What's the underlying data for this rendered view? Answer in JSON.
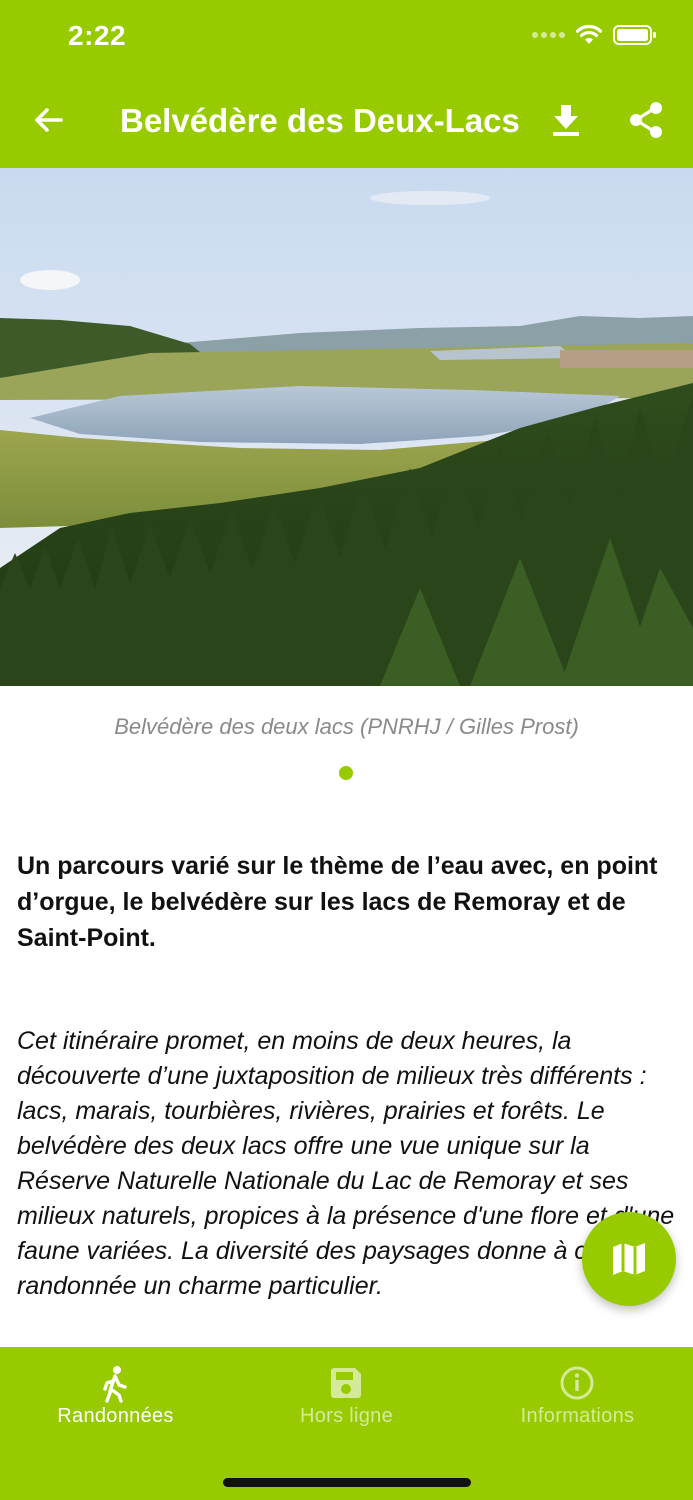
{
  "status_bar": {
    "time": "2:22"
  },
  "header": {
    "title": "Belvédère des Deux-Lacs"
  },
  "icons": {
    "back": "back-arrow-icon",
    "download": "download-icon",
    "share": "share-icon",
    "map": "map-icon",
    "hike": "hiker-icon",
    "offline": "save-icon",
    "info": "info-icon"
  },
  "photo": {
    "caption": "Belvédère des deux lacs (PNRHJ / Gilles Prost)"
  },
  "content": {
    "intro": "Un parcours varié sur le thème de l’eau avec, en point d’orgue, le belvédère sur les lacs de Remoray et de Saint-Point.",
    "description": "Cet itinéraire promet, en moins de deux heures, la découverte d’une juxtaposition de milieux très différents : lacs, marais, tourbières, rivières, prairies et forêts. Le belvédère des deux lacs offre une vue unique sur la Réserve Naturelle Nationale du Lac de Remoray et ses milieux naturels, propices à la présence d'une flore et d'une faune variées. La diversité des paysages donne à cette randonnée un charme particulier."
  },
  "bottom_nav": [
    {
      "label": "Randonnées",
      "active": true
    },
    {
      "label": "Hors ligne",
      "active": false
    },
    {
      "label": "Informations",
      "active": false
    }
  ],
  "colors": {
    "accent": "#97cb00",
    "text": "#111111",
    "caption": "#8a8a8a"
  }
}
